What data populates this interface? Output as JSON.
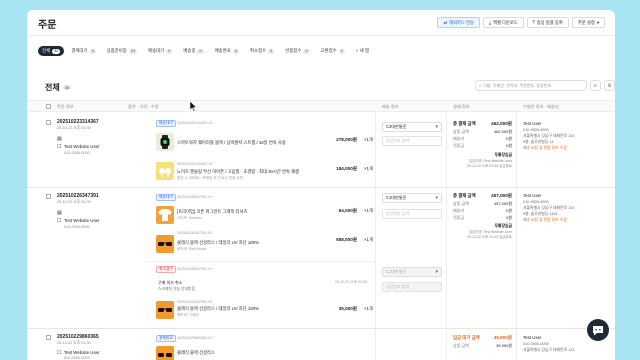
{
  "header": {
    "title": "주문",
    "buttons": [
      "해외카드 연동",
      "엑셀 다운로드",
      "송장 일괄 등록",
      "주문 설정"
    ]
  },
  "tabs": [
    {
      "label": "전체",
      "count": "30"
    },
    {
      "label": "결제대기",
      "count": "3"
    },
    {
      "label": "상품준비중",
      "count": "23"
    },
    {
      "label": "배송대기",
      "count": "0"
    },
    {
      "label": "배송중",
      "count": "0"
    },
    {
      "label": "배송완료",
      "count": "0"
    },
    {
      "label": "취소접수",
      "count": "0"
    },
    {
      "label": "반품접수",
      "count": "0"
    },
    {
      "label": "교환접수",
      "count": "0"
    },
    {
      "label": "+ 새 탭",
      "count": ""
    }
  ],
  "list": {
    "title": "전체",
    "count": "30",
    "search_placeholder": "이름, 이메일, 연락처, 주문번호, 송장번호"
  },
  "columns": {
    "order_info": "주문 정보",
    "items": "품목 · 가격 · 수량",
    "shipping": "배송 정보",
    "payment": "결제 정보",
    "recipient": "수령인 정보 · 배송지"
  },
  "orders": [
    {
      "number": "202510223314367",
      "date": "25-10-22 오후 01:00",
      "customer": "Test Website User",
      "phone": "010-0000-0000",
      "status": "배송대기",
      "courier": "CJ대한통운",
      "invoice_placeholder": "송장번호 입력",
      "pay_title": "총 결제 금액",
      "pay_total": "462,000원",
      "pay_rows": [
        [
          "상품 금액",
          "462,000원"
        ],
        [
          "배송비",
          "0원"
        ],
        [
          "적립금",
          "0원"
        ]
      ],
      "pay_method": "무통장입금",
      "pay_note": "입금자명: Test Website User",
      "pay_date": "25-10-22 오후 01:00 입금완료",
      "recipient": "Test User",
      "recipient_phone": "010-9834-4500",
      "address": "서울특별시 강남구 테헤란로 123",
      "address2": "5층, 솔루션빌딩 14",
      "delivery_link": "배송 요청 및 반품 정보 수정",
      "items": [
        {
          "id": "2025102201414D7-01",
          "name": "스마트워치 웨어러블 블랙 / 심박센서 스트랩 / 10일 연속 사용",
          "option": "",
          "price": "278,000원",
          "qty": "×1개"
        },
        {
          "id": "2025102201414D7-02",
          "name": "노이즈 캔슬링 무선 이어폰 / 고음질 · 초경량 · 최대 30시간 연속 재생",
          "option": "옵션 2 / 화이트 / 포함된 추가 로고 반대 교체",
          "price": "184,000원",
          "qty": "×1개"
        }
      ]
    },
    {
      "number": "202510226347391",
      "date": "25-10-22 오후 01:00",
      "customer": "Test Website User",
      "phone": "010-0000-0000",
      "status": "배송대기",
      "courier": "CJ대한통운",
      "invoice_placeholder": "송장번호 입력",
      "pay_title": "총 결제 금액",
      "pay_total": "457,000원",
      "pay_rows": [
        [
          "상품 금액",
          "457,000원"
        ],
        [
          "배송비",
          "0원"
        ],
        [
          "적립금",
          "0원"
        ]
      ],
      "pay_method": "무통장입금",
      "pay_note": "입금자명: Test Website User",
      "pay_date": "25-10-22 오후 01:00 입금완료",
      "recipient": "Test User",
      "recipient_phone": "010-9834-4500",
      "address": "서울특별시 강남구 테헤란로 123",
      "address2": "5층, 솔루션빌딩 1451",
      "delivery_link": "배송 요청 및 반품 정보 수정",
      "items": [
        {
          "id": "202510226347391-01",
          "name": "[프리미엄] 코튼 피그먼트 그래픽 티셔츠",
          "option": "사이즈: Medium",
          "price": "64,000원",
          "qty": "×1개"
        },
        {
          "id": "202510226347391-02",
          "name": "클래식 블랙 선글라스 / 데일리 UV 차단 100%",
          "option": "렌즈색: Soft Brown",
          "price": "558,000원",
          "qty": "×1개"
        }
      ],
      "cancel": {
        "status": "취소접수",
        "id": "202510226347391-01",
        "reason": "구매 의사 취소",
        "detail": "스크래치 가능 안내받음",
        "date": "25-10-22 오후 02:00",
        "item": {
          "id": "202510226347391-03",
          "name": "클래식 블랙 선글라스 / 데일리 UV 차단 100%",
          "option": "렌즈색: 그레이",
          "price": "35,000원",
          "qty": "×1개"
        }
      }
    },
    {
      "number": "202510229860365",
      "date": "25-10-22 오후 01:00",
      "customer": "Test Website User",
      "phone": "010-0000-0000",
      "status": "결제완료",
      "pay_title": "입금 대기 금액",
      "pay_total": "39,900원",
      "pay_rows": [
        [
          "상품 금액",
          "39,900원"
        ]
      ],
      "recipient": "Test User",
      "recipient_phone": "010-0000-0000",
      "address": "서울특별시 강남구 테헤란로 123",
      "items": [
        {
          "id": "202510229860365-01",
          "name": "클래식 블랙 선글라스",
          "option": "",
          "price": "",
          "qty": ""
        }
      ]
    }
  ]
}
